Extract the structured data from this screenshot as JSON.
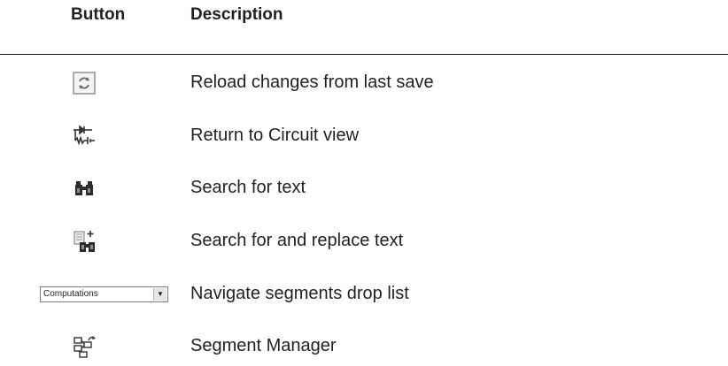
{
  "header": {
    "button_col": "Button",
    "description_col": "Description"
  },
  "rows": [
    {
      "icon": "reload-icon",
      "description": "Reload changes from last save"
    },
    {
      "icon": "circuit-view-icon",
      "description": "Return to Circuit view"
    },
    {
      "icon": "binoculars-icon",
      "description": "Search for text"
    },
    {
      "icon": "search-replace-icon",
      "description": "Search for and replace text"
    },
    {
      "icon": "droplist",
      "description": "Navigate segments drop list",
      "droplist_value": "Computations"
    },
    {
      "icon": "segment-manager-icon",
      "description": "Segment Manager"
    }
  ]
}
